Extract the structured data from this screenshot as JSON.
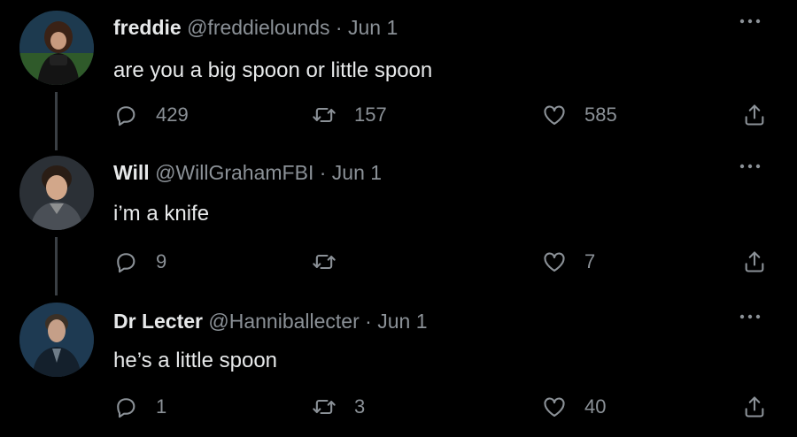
{
  "colors": {
    "background": "#000000",
    "primary_text": "#e7e9ea",
    "secondary_text": "#8b9197",
    "thread_line": "#3a3f44"
  },
  "tweets": [
    {
      "name": "freddie",
      "handle": "@freddielounds",
      "separator": "·",
      "date": "Jun 1",
      "text": "are you a big spoon or little spoon",
      "reply_count": "429",
      "retweet_count": "157",
      "like_count": "585",
      "avatar_icon": "avatar-photo"
    },
    {
      "name": "Will",
      "handle": "@WillGrahamFBI",
      "separator": "·",
      "date": "Jun 1",
      "text": "i’m a knife",
      "reply_count": "9",
      "retweet_count": "",
      "like_count": "7",
      "avatar_icon": "avatar-photo"
    },
    {
      "name": "Dr Lecter",
      "handle": "@Hanniballecter",
      "separator": "·",
      "date": "Jun 1",
      "text": "he’s a little spoon",
      "reply_count": "1",
      "retweet_count": "3",
      "like_count": "40",
      "avatar_icon": "avatar-photo"
    }
  ],
  "icons": {
    "reply": "reply-icon",
    "retweet": "retweet-icon",
    "like": "heart-icon",
    "share": "share-icon",
    "more": "more-options-icon"
  }
}
